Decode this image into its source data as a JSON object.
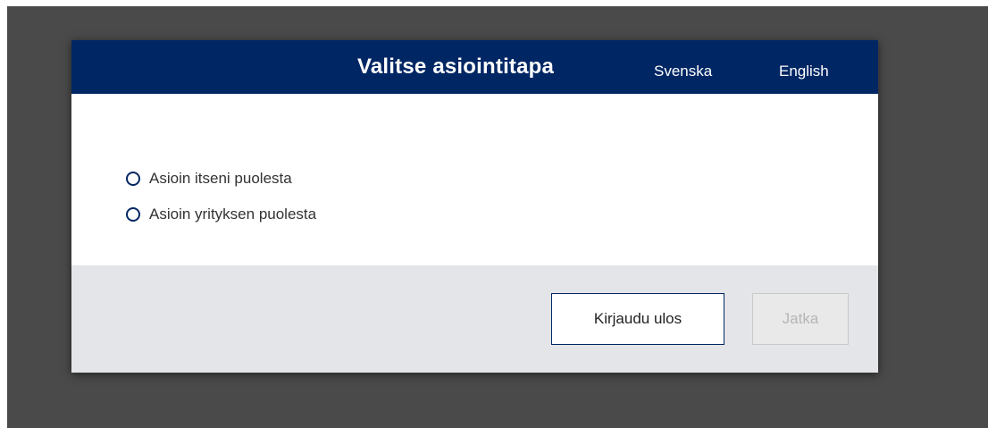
{
  "dialog": {
    "title": "Valitse asiointitapa",
    "languages": {
      "swedish": "Svenska",
      "english": "English"
    },
    "options": [
      {
        "label": "Asioin itseni puolesta",
        "selected": false
      },
      {
        "label": "Asioin yrityksen puolesta",
        "selected": false
      }
    ],
    "buttons": {
      "logout": "Kirjaudu ulos",
      "continue": "Jatka",
      "continue_disabled": true
    }
  },
  "colors": {
    "header_bg": "#002664",
    "backdrop": "#4a4a4a",
    "footer_bg": "#e4e5e8"
  }
}
